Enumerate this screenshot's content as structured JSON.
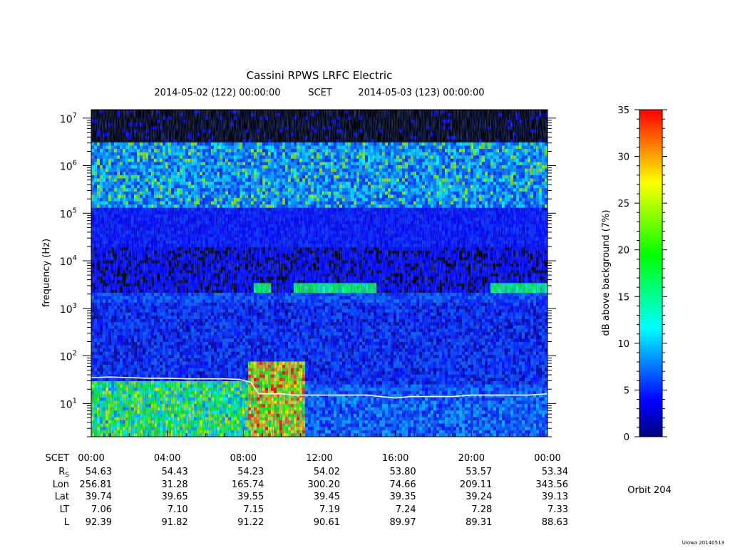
{
  "chart_data": {
    "type": "heatmap",
    "title": "Cassini RPWS LRFC Electric",
    "subtitle": {
      "start": "2014-05-02 (122) 00:00:00",
      "frame": "SCET",
      "end": "2014-05-03 (123) 00:00:00"
    },
    "ylabel": "frequency (Hz)",
    "yscale": "log",
    "ylim": [
      2,
      15000000
    ],
    "ytick_labels": [
      {
        "base": "10",
        "exp": "1",
        "value": 10
      },
      {
        "base": "10",
        "exp": "2",
        "value": 100
      },
      {
        "base": "10",
        "exp": "3",
        "value": 1000
      },
      {
        "base": "10",
        "exp": "4",
        "value": 10000
      },
      {
        "base": "10",
        "exp": "5",
        "value": 100000
      },
      {
        "base": "10",
        "exp": "6",
        "value": 1000000
      },
      {
        "base": "10",
        "exp": "7",
        "value": 10000000
      }
    ],
    "xlim_hours": [
      0,
      24
    ],
    "xtick_hours": [
      0,
      4,
      8,
      12,
      16,
      20,
      24
    ],
    "colorbar": {
      "label": "dB above background (7%)",
      "range": [
        0,
        35
      ],
      "ticks": [
        0,
        5,
        10,
        15,
        20,
        25,
        30,
        35
      ],
      "colors": [
        "#00007f",
        "#0000ff",
        "#0080ff",
        "#00ffff",
        "#00ff80",
        "#00ff00",
        "#80ff00",
        "#ffff00",
        "#ff8000",
        "#ff0000"
      ]
    },
    "background_color": "#000000",
    "electron_cyclotron_line": {
      "color": "#ffffff",
      "points": [
        [
          0.0,
          35
        ],
        [
          1.0,
          36
        ],
        [
          2.0,
          35
        ],
        [
          3.0,
          34
        ],
        [
          4.0,
          34
        ],
        [
          5.0,
          33
        ],
        [
          6.0,
          33
        ],
        [
          7.0,
          33
        ],
        [
          7.8,
          32
        ],
        [
          8.4,
          28
        ],
        [
          8.8,
          16
        ],
        [
          9.5,
          16
        ],
        [
          10.0,
          16
        ],
        [
          10.6,
          15
        ],
        [
          11.5,
          15
        ],
        [
          12.5,
          15
        ],
        [
          13.5,
          15
        ],
        [
          14.5,
          15
        ],
        [
          15.2,
          14
        ],
        [
          16.0,
          13
        ],
        [
          16.8,
          14
        ],
        [
          18.0,
          14
        ],
        [
          19.0,
          14
        ],
        [
          20.0,
          15
        ],
        [
          21.0,
          15
        ],
        [
          22.0,
          15
        ],
        [
          23.0,
          15
        ],
        [
          24.0,
          16
        ]
      ]
    }
  },
  "ephemeris": {
    "labels": {
      "scet": "SCET",
      "rs": "R",
      "rs_sub": "S",
      "lon": "Lon",
      "lat": "Lat",
      "lt": "LT",
      "l": "L"
    },
    "times": [
      "00:00",
      "04:00",
      "08:00",
      "12:00",
      "16:00",
      "20:00",
      "00:00"
    ],
    "rs": [
      "54.63",
      "54.43",
      "54.23",
      "54.02",
      "53.80",
      "53.57",
      "53.34"
    ],
    "lon": [
      "256.81",
      "31.28",
      "165.74",
      "300.20",
      "74.66",
      "209.11",
      "343.56"
    ],
    "lat": [
      "39.74",
      "39.65",
      "39.55",
      "39.45",
      "39.35",
      "39.24",
      "39.13"
    ],
    "lt": [
      "7.06",
      "7.10",
      "7.15",
      "7.19",
      "7.24",
      "7.28",
      "7.33"
    ],
    "l": [
      "92.39",
      "91.82",
      "91.22",
      "90.61",
      "89.97",
      "89.31",
      "88.63"
    ]
  },
  "orbit_label": "Orbit 204",
  "footer": "Uiowa 20140513"
}
